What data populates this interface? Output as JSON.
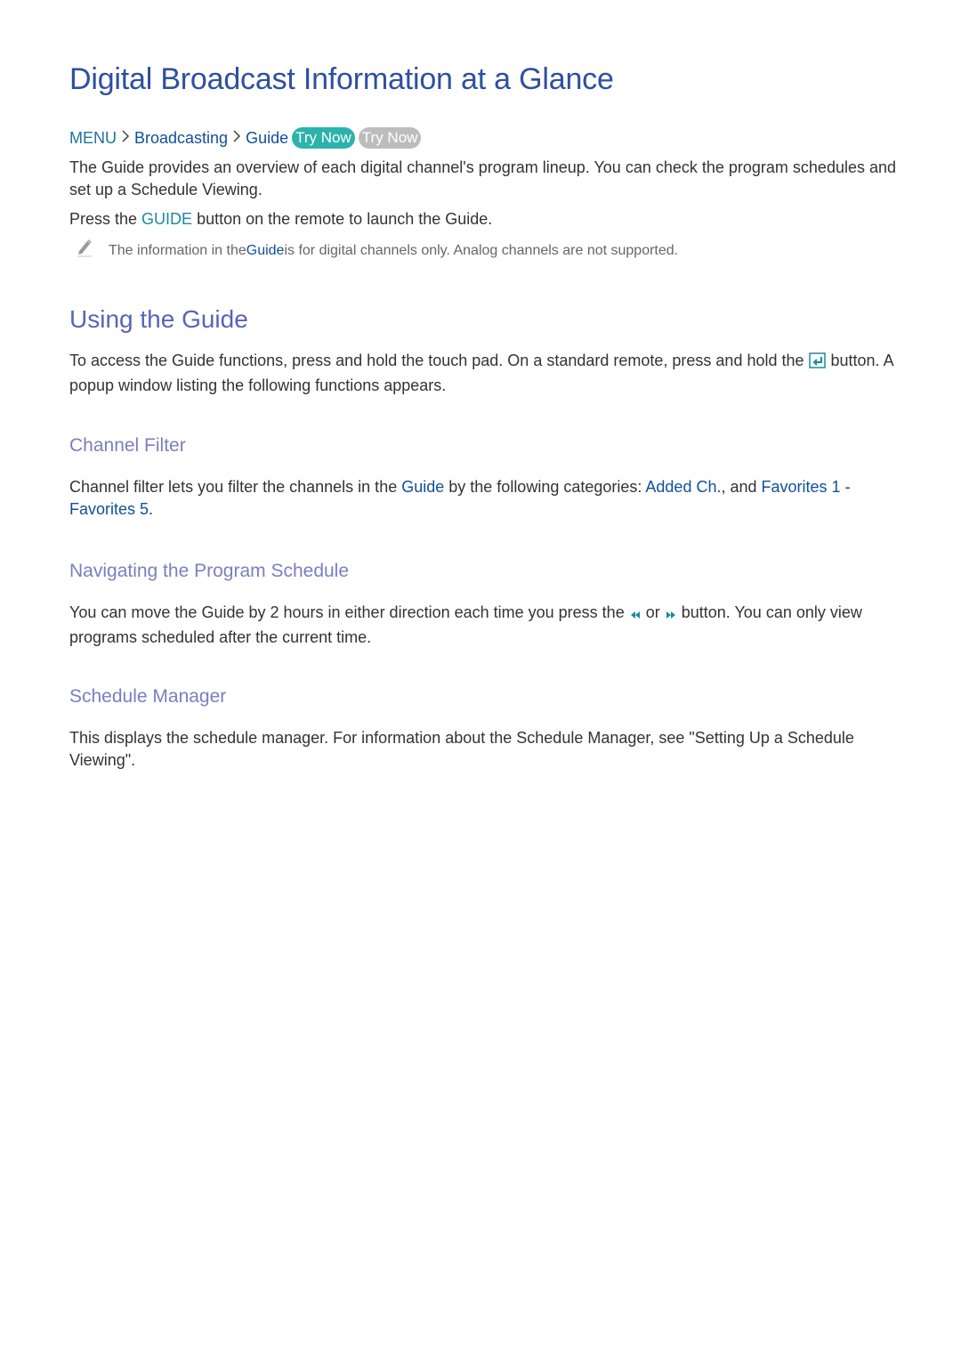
{
  "page": {
    "title": "Digital Broadcast Information at a Glance",
    "breadcrumb": {
      "items": [
        "MENU",
        "Broadcasting",
        "Guide"
      ],
      "separator_icon": "chevron-right-icon",
      "try_now_active": "Try Now",
      "try_now_inactive": "Try Now"
    },
    "intro": {
      "p1": "The Guide provides an overview of each digital channel's program lineup. You can check the program schedules and set up a Schedule Viewing.",
      "p2_before": "Press the ",
      "p2_key": "GUIDE",
      "p2_after": " button on the remote to launch the Guide."
    },
    "note": {
      "icon": "pencil-icon",
      "before": "The information in the ",
      "link": "Guide",
      "after": " is for digital channels only. Analog channels are not supported."
    },
    "using_guide": {
      "heading": "Using the Guide",
      "text_before": "To access the Guide functions, press and hold the touch pad. On a standard remote, press and hold the ",
      "icon": "enter-button-icon",
      "text_after": " button. A popup window listing the following functions appears."
    },
    "channel_filter": {
      "heading": "Channel Filter",
      "t1": "Channel filter lets you filter the channels in the ",
      "link1": "Guide",
      "t2": " by the following categories: ",
      "link2": "Added Ch.",
      "t3": ", and ",
      "link3": "Favorites 1",
      "t4": " - ",
      "link4": "Favorites 5",
      "t5": "."
    },
    "navigating": {
      "heading": "Navigating the Program Schedule",
      "t1": "You can move the Guide by 2 hours in either direction each time you press the ",
      "icon1": "rewind-icon",
      "t2": " or ",
      "icon2": "fast-forward-icon",
      "t3": " button. You can only view programs scheduled after the current time."
    },
    "schedule_manager": {
      "heading": "Schedule Manager",
      "text": "This displays the schedule manager. For information about the Schedule Manager, see \"Setting Up a Schedule Viewing\"."
    }
  },
  "colors": {
    "title": "#2e50a0",
    "section_heading": "#5a64b8",
    "subheading": "#7c7ec0",
    "link": "#10509a",
    "try_now_active": "#2bb3ac",
    "try_now_inactive": "#bdbdbd",
    "icon_accent": "#1a8aa0"
  }
}
